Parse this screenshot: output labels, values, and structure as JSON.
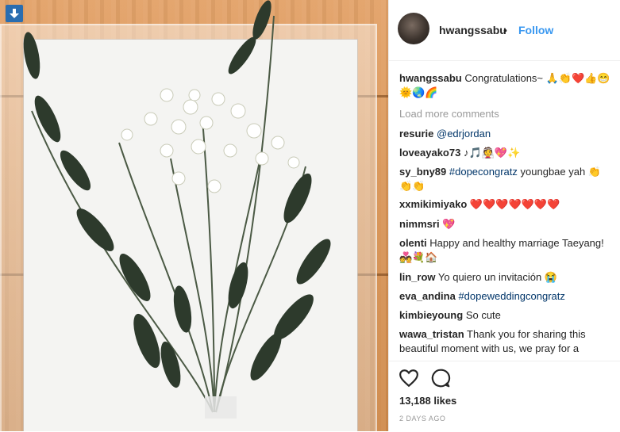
{
  "header": {
    "username": "hwangssabu",
    "separator": "•",
    "follow_label": "Follow"
  },
  "comments": {
    "load_more": "Load more comments",
    "items": [
      {
        "user": "hwangssabu",
        "text": "Congratulations~ 🙏👏❤️👍😁🌞🌏🌈"
      },
      {
        "user": "resurie",
        "text": "@edrjordan"
      },
      {
        "user": "loveayako73",
        "text": "♪🎵👰💖✨"
      },
      {
        "user": "sy_bny89",
        "tag": "#dopecongratz",
        "text": " youngbae yah 👏👏👏"
      },
      {
        "user": "xxmikimiyako",
        "text": "❤️❤️❤️❤️❤️❤️❤️"
      },
      {
        "user": "nimmsri",
        "text": "💖"
      },
      {
        "user": "olenti",
        "text": "Happy and healthy marriage Taeyang! 💑💐🏠"
      },
      {
        "user": "lin_row",
        "text": "Yo quiero un invitación 😭"
      },
      {
        "user": "eva_andina",
        "tag": "#dopeweddingcongratz",
        "text": ""
      },
      {
        "user": "kimbieyoung",
        "text": "So cute"
      },
      {
        "user": "wawa_tristan",
        "text": "Thank you for sharing this beautiful moment with us, we pray for a"
      }
    ]
  },
  "actions": {
    "likes": "13,188 likes",
    "time_ago": "2 DAYS AGO"
  },
  "colors": {
    "accent": "#3897f0",
    "hashtag": "#003569",
    "muted": "#999999",
    "text": "#262626"
  },
  "icons": {
    "download": "download-arrow-icon",
    "like": "heart-icon",
    "comment": "comment-icon"
  }
}
